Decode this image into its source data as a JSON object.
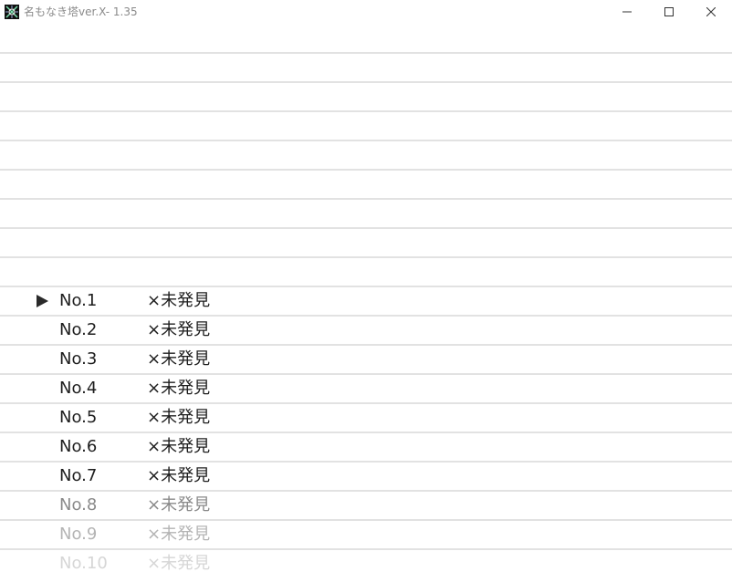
{
  "window": {
    "title": "名もなき塔ver.X- 1.35",
    "minimize_glyph": "—",
    "maximize_glyph": "☐",
    "close_glyph": "✕"
  },
  "list": {
    "selected_index": 0,
    "items": [
      {
        "no": "No.1",
        "status": "×未発見",
        "color": "#1e1e1e"
      },
      {
        "no": "No.2",
        "status": "×未発見",
        "color": "#1e1e1e"
      },
      {
        "no": "No.3",
        "status": "×未発見",
        "color": "#1e1e1e"
      },
      {
        "no": "No.4",
        "status": "×未発見",
        "color": "#1e1e1e"
      },
      {
        "no": "No.5",
        "status": "×未発見",
        "color": "#1e1e1e"
      },
      {
        "no": "No.6",
        "status": "×未発見",
        "color": "#1e1e1e"
      },
      {
        "no": "No.7",
        "status": "×未発見",
        "color": "#1e1e1e"
      },
      {
        "no": "No.8",
        "status": "×未発見",
        "color": "#8a8a8a"
      },
      {
        "no": "No.9",
        "status": "×未発見",
        "color": "#b4b4b4"
      },
      {
        "no": "No.10",
        "status": "×未発見",
        "color": "#d6d6d6"
      }
    ]
  },
  "colors": {
    "divider": "#e2e2e2",
    "cursor": "#2a2a2a"
  }
}
